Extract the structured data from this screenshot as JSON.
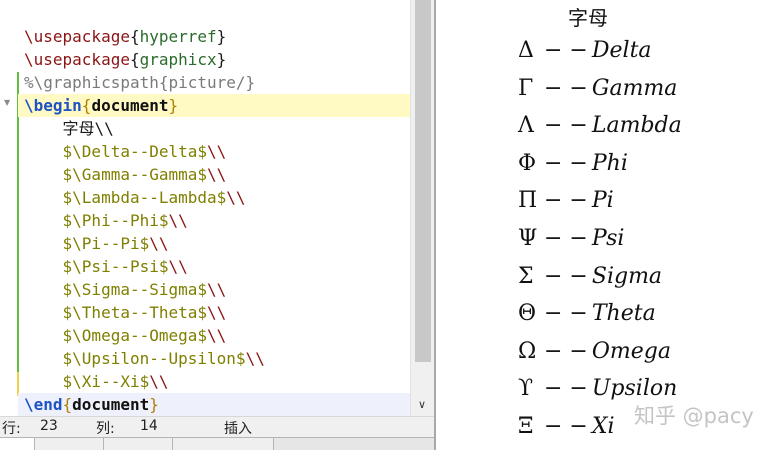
{
  "editor": {
    "lines": [
      {
        "parts": [
          [
            "cmd",
            "\\usepackage"
          ],
          [
            "brace",
            "{"
          ],
          [
            "arg",
            "hyperref"
          ],
          [
            "brace",
            "}"
          ]
        ]
      },
      {
        "parts": [
          [
            "cmd",
            "\\usepackage"
          ],
          [
            "brace",
            "{"
          ],
          [
            "arg",
            "graphicx"
          ],
          [
            "brace",
            "}"
          ]
        ]
      },
      {
        "parts": [
          [
            "cmt",
            "%\\graphicspath{picture/}"
          ]
        ]
      },
      {
        "hl": true,
        "parts": [
          [
            "cmd-b",
            "\\begin"
          ],
          [
            "brace-b",
            "{"
          ],
          [
            "arg-b",
            "document"
          ],
          [
            "brace-b",
            "}"
          ]
        ]
      },
      {
        "parts": [
          [
            "plain",
            "    字母\\\\"
          ]
        ]
      },
      {
        "parts": [
          [
            "plain",
            "    "
          ],
          [
            "math",
            "$\\Delta--Delta$"
          ],
          [
            "cmd",
            "\\\\"
          ]
        ]
      },
      {
        "parts": [
          [
            "plain",
            "    "
          ],
          [
            "math",
            "$\\Gamma--Gamma$"
          ],
          [
            "cmd",
            "\\\\"
          ]
        ]
      },
      {
        "parts": [
          [
            "plain",
            "    "
          ],
          [
            "math",
            "$\\Lambda--Lambda$"
          ],
          [
            "cmd",
            "\\\\"
          ]
        ]
      },
      {
        "parts": [
          [
            "plain",
            "    "
          ],
          [
            "math",
            "$\\Phi--Phi$"
          ],
          [
            "cmd",
            "\\\\"
          ]
        ]
      },
      {
        "parts": [
          [
            "plain",
            "    "
          ],
          [
            "math",
            "$\\Pi--Pi$"
          ],
          [
            "cmd",
            "\\\\"
          ]
        ]
      },
      {
        "parts": [
          [
            "plain",
            "    "
          ],
          [
            "math",
            "$\\Psi--Psi$"
          ],
          [
            "cmd",
            "\\\\"
          ]
        ]
      },
      {
        "parts": [
          [
            "plain",
            "    "
          ],
          [
            "math",
            "$\\Sigma--Sigma$"
          ],
          [
            "cmd",
            "\\\\"
          ]
        ]
      },
      {
        "parts": [
          [
            "plain",
            "    "
          ],
          [
            "math",
            "$\\Theta--Theta$"
          ],
          [
            "cmd",
            "\\\\"
          ]
        ]
      },
      {
        "parts": [
          [
            "plain",
            "    "
          ],
          [
            "math",
            "$\\Omega--Omega$"
          ],
          [
            "cmd",
            "\\\\"
          ]
        ]
      },
      {
        "parts": [
          [
            "plain",
            "    "
          ],
          [
            "math",
            "$\\Upsilon--Upsilon$"
          ],
          [
            "cmd",
            "\\\\"
          ]
        ]
      },
      {
        "parts": [
          [
            "plain",
            "    "
          ],
          [
            "math",
            "$\\Xi--Xi$"
          ],
          [
            "cmd",
            "\\\\"
          ]
        ]
      },
      {
        "cur": true,
        "parts": [
          [
            "cmd-b",
            "\\end"
          ],
          [
            "brace-b",
            "{"
          ],
          [
            "arg-b",
            "document"
          ],
          [
            "brace-b",
            "}"
          ]
        ]
      }
    ]
  },
  "status": {
    "row_label": "行:",
    "row_value": "23",
    "col_label": "列:",
    "col_value": "14",
    "mode": "插入"
  },
  "output": {
    "title": "字母",
    "rows": [
      {
        "sym": "Δ",
        "dash": "− −",
        "name": "Delta"
      },
      {
        "sym": "Γ",
        "dash": "− −",
        "name": "Gamma"
      },
      {
        "sym": "Λ",
        "dash": "− −",
        "name": "Lambda"
      },
      {
        "sym": "Φ",
        "dash": "− −",
        "name": "Phi"
      },
      {
        "sym": "Π",
        "dash": "− −",
        "name": "Pi"
      },
      {
        "sym": "Ψ",
        "dash": "− −",
        "name": "Psi"
      },
      {
        "sym": "Σ",
        "dash": "− −",
        "name": "Sigma"
      },
      {
        "sym": "Θ",
        "dash": "− −",
        "name": "Theta"
      },
      {
        "sym": "Ω",
        "dash": "− −",
        "name": "Omega"
      },
      {
        "sym": "ϒ",
        "dash": "− −",
        "name": "Upsilon"
      },
      {
        "sym": "Ξ",
        "dash": "− −",
        "name": "Xi"
      }
    ]
  },
  "watermark": "知乎 @pacy",
  "icons": {
    "fold": "fold-marker-icon",
    "scroll_down": "chevron-down-icon"
  },
  "colors": {
    "command": "#8b1414",
    "environment": "#1f52c5",
    "argument": "#2b6b2b",
    "comment": "#7a7a7a",
    "math": "#7f7f00",
    "fold_line": "#5fbf3f"
  }
}
